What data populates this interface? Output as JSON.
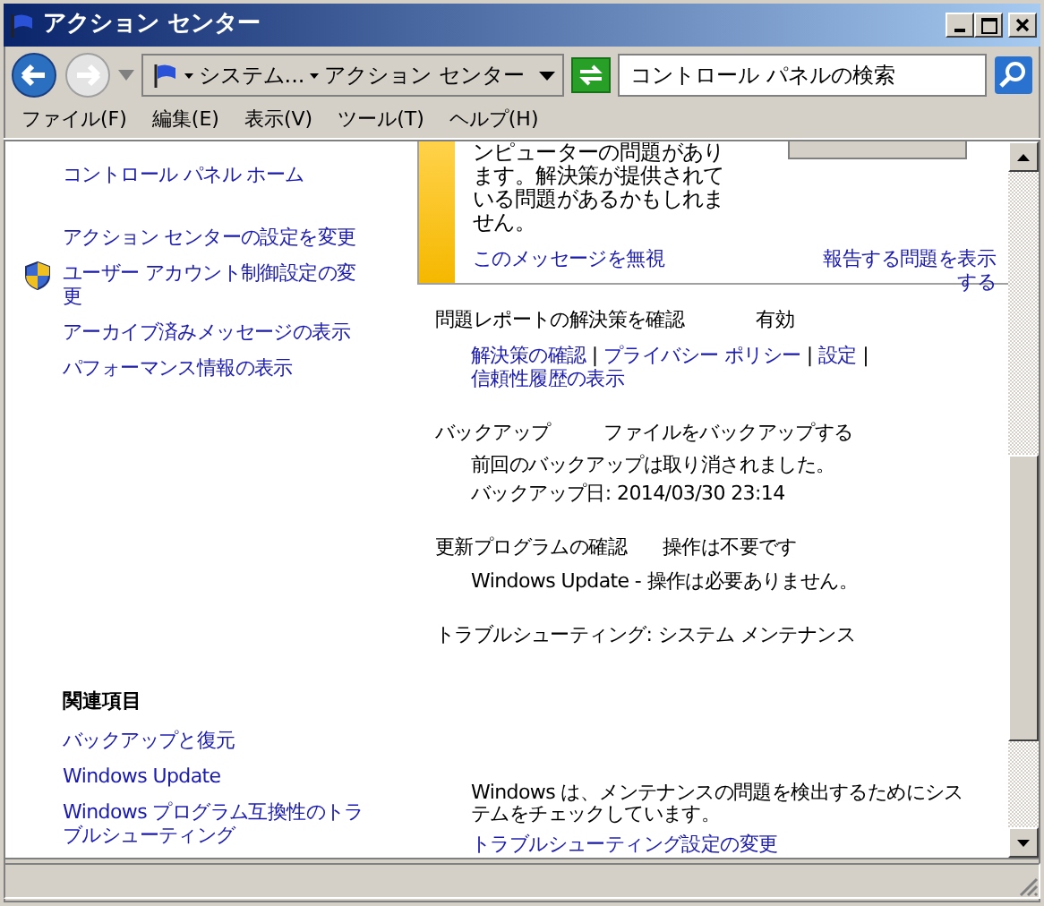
{
  "window": {
    "title": "アクション センター"
  },
  "address": {
    "crumbs": [
      "システム...",
      "アクション センター"
    ]
  },
  "search": {
    "placeholder": "コントロール パネルの検索"
  },
  "menu": [
    "ファイル(F)",
    "編集(E)",
    "表示(V)",
    "ツール(T)",
    "ヘルプ(H)"
  ],
  "sidebar": {
    "home": "コントロール パネル ホーム",
    "tasks": [
      {
        "label": "アクション センターの設定を変更",
        "kind": "link"
      },
      {
        "label": "ユーザー アカウント制御設定の変更",
        "kind": "shield"
      },
      {
        "label": "アーカイブ済みメッセージの表示",
        "kind": "link"
      },
      {
        "label": "パフォーマンス情報の表示",
        "kind": "link"
      }
    ],
    "related_title": "関連項目",
    "related": [
      "バックアップと復元",
      "Windows Update",
      "Windows プログラム互換性のトラブルシューティング"
    ]
  },
  "message": {
    "text": "ンピューターの問題があります。解決策が提供されている問題があるかもしれません。",
    "ignore_link": "このメッセージを無視",
    "view_link": "報告する問題を表示する"
  },
  "sections": [
    {
      "title": "問題レポートの解決策を確認",
      "status": "有効",
      "separator": "|",
      "links": [
        "解決策の確認",
        "プライバシー ポリシー",
        "設定",
        "信頼性履歴の表示"
      ]
    },
    {
      "title": "バックアップ",
      "status": "ファイルをバックアップする",
      "details": [
        "前回のバックアップは取り消されました。",
        "バックアップ日: 2014/03/30 23:14"
      ]
    },
    {
      "title": "更新プログラムの確認",
      "status": "操作は不要です",
      "details": [
        "Windows Update - 操作は必要ありません。"
      ]
    },
    {
      "title": "トラブルシューティング: システム メンテナンス",
      "details": [
        "Windows は、メンテナンスの問題を検出するためにシステムをチェックしています。"
      ],
      "links": [
        "トラブルシューティング設定の変更"
      ]
    }
  ]
}
